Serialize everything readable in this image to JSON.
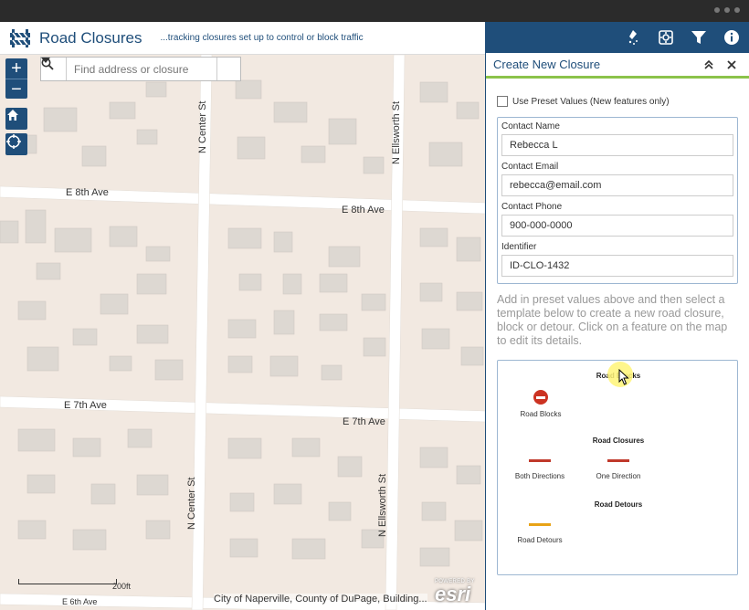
{
  "header": {
    "title": "Road Closures",
    "subtitle": "...tracking closures set up to control or block traffic"
  },
  "search": {
    "placeholder": "Find address or closure"
  },
  "map": {
    "zoom_in": "+",
    "zoom_out": "−",
    "streets": {
      "e8th_left": "E 8th Ave",
      "e8th_right": "E 8th Ave",
      "e7th_left": "E 7th Ave",
      "e7th_right": "E 7th Ave",
      "e6th": "E 6th Ave",
      "center_top": "N Center St",
      "center_bottom": "N Center St",
      "ellsworth_top": "N Ellsworth St",
      "ellsworth_bottom": "N Ellsworth St"
    },
    "scale_label": "200ft",
    "attribution": "City of Naperville, County of DuPage, Building...",
    "esri_powered": "POWERED BY",
    "esri_logo": "esri"
  },
  "toolbar": {
    "icons": [
      "edit-icon",
      "settings-icon",
      "filter-icon",
      "info-icon"
    ]
  },
  "panel": {
    "title": "Create New Closure",
    "preset_label": "Use Preset Values (New features only)",
    "preset_checked": false,
    "fields": [
      {
        "label": "Contact Name",
        "value": "Rebecca L"
      },
      {
        "label": "Contact Email",
        "value": "rebecca@email.com"
      },
      {
        "label": "Contact Phone",
        "value": "900-000-0000"
      },
      {
        "label": "Identifier",
        "value": "ID-CLO-1432"
      }
    ],
    "instructions": "Add in preset values above and then select a template below to create a new road closure, block or detour. Click on a feature on the map to edit its details.",
    "templates": {
      "blocks_title": "Road Blocks",
      "block_item": "Road Blocks",
      "closures_title": "Road Closures",
      "both_directions": "Both Directions",
      "one_direction": "One Direction",
      "detours_title": "Road Detours",
      "detour_item": "Road Detours"
    }
  },
  "colors": {
    "brand": "#1f4e7a",
    "accent": "#8bc34a",
    "closure_line": "#c0392b",
    "detour_line": "#e8a317",
    "block_icon": "#cc3322"
  }
}
